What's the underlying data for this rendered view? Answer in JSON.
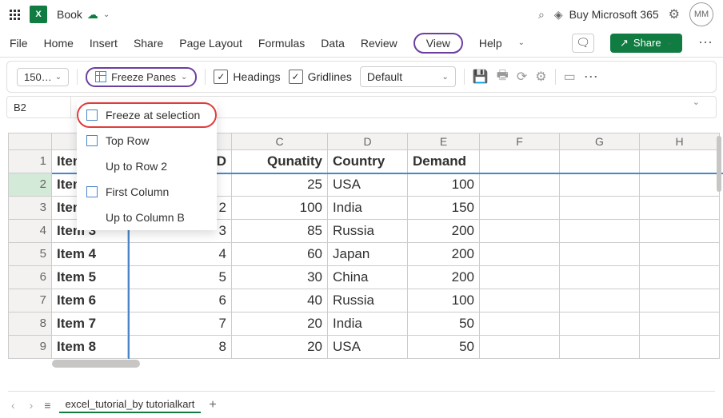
{
  "titlebar": {
    "docName": "Book",
    "buyText": "Buy Microsoft 365",
    "avatar": "MM"
  },
  "menubar": {
    "items": [
      "File",
      "Home",
      "Insert",
      "Share",
      "Page Layout",
      "Formulas",
      "Data",
      "Review",
      "View",
      "Help"
    ],
    "active": "View",
    "shareBtn": "Share"
  },
  "toolbar": {
    "zoom": "150…",
    "freeze": "Freeze Panes",
    "headings": "Headings",
    "gridlines": "Gridlines",
    "style": "Default"
  },
  "namebox": {
    "ref": "B2"
  },
  "dropdown": {
    "freezeSelection": "Freeze at selection",
    "topRow": "Top Row",
    "upToRow": "Up to Row 2",
    "firstCol": "First Column",
    "upToCol": "Up to Column B"
  },
  "grid": {
    "cols": [
      "C",
      "D",
      "E",
      "F",
      "G",
      "H"
    ],
    "headers": [
      "Item",
      "",
      "Qunatity",
      "Country",
      "Demand"
    ],
    "headerB_end": "D",
    "rows": [
      {
        "n": "2",
        "a": "Item",
        "b": "",
        "c": "25",
        "d": "USA",
        "e": "100"
      },
      {
        "n": "3",
        "a": "Item",
        "b": "2",
        "c": "100",
        "d": "India",
        "e": "150"
      },
      {
        "n": "4",
        "a": "Item 3",
        "b": "3",
        "c": "85",
        "d": "Russia",
        "e": "200"
      },
      {
        "n": "5",
        "a": "Item 4",
        "b": "4",
        "c": "60",
        "d": "Japan",
        "e": "200"
      },
      {
        "n": "6",
        "a": "Item 5",
        "b": "5",
        "c": "30",
        "d": "China",
        "e": "200"
      },
      {
        "n": "7",
        "a": "Item 6",
        "b": "6",
        "c": "40",
        "d": "Russia",
        "e": "100"
      },
      {
        "n": "8",
        "a": "Item 7",
        "b": "7",
        "c": "20",
        "d": "India",
        "e": "50"
      },
      {
        "n": "9",
        "a": "Item 8",
        "b": "8",
        "c": "20",
        "d": "USA",
        "e": "50"
      }
    ]
  },
  "tabs": {
    "sheet": "excel_tutorial_by tutorialkart"
  }
}
